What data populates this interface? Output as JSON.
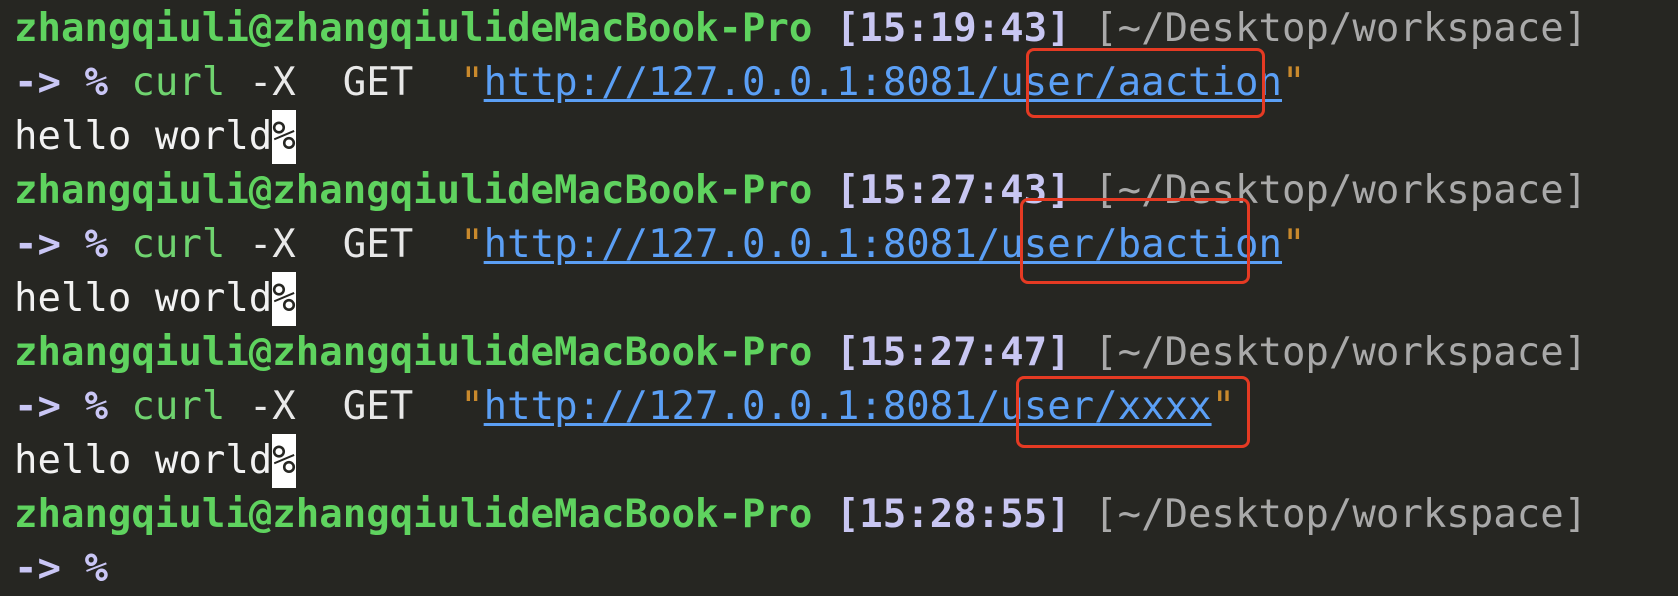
{
  "session": {
    "blocks": [
      {
        "prompt": {
          "user": "zhangqiuli@zhangqiulideMacBook-Pro",
          "time": "[15:19:43]",
          "path": "[~/Desktop/workspace]"
        },
        "command": {
          "arrow": "->",
          "symbol": "%",
          "cmd": "curl",
          "flag": "-X",
          "method": "GET",
          "open_quote": "\"",
          "url": "http://127.0.0.1:8081/user/aaction",
          "close_quote": "\""
        },
        "output": "hello world",
        "cursor": "%"
      },
      {
        "prompt": {
          "user": "zhangqiuli@zhangqiulideMacBook-Pro",
          "time": "[15:27:43]",
          "path": "[~/Desktop/workspace]"
        },
        "command": {
          "arrow": "->",
          "symbol": "%",
          "cmd": "curl",
          "flag": "-X",
          "method": "GET",
          "open_quote": "\"",
          "url": "http://127.0.0.1:8081/user/baction",
          "close_quote": "\""
        },
        "output": "hello world",
        "cursor": "%"
      },
      {
        "prompt": {
          "user": "zhangqiuli@zhangqiulideMacBook-Pro",
          "time": "[15:27:47]",
          "path": "[~/Desktop/workspace]"
        },
        "command": {
          "arrow": "->",
          "symbol": "%",
          "cmd": "curl",
          "flag": "-X",
          "method": "GET",
          "open_quote": "\"",
          "url": "http://127.0.0.1:8081/user/xxxx",
          "close_quote": "\""
        },
        "output": "hello world",
        "cursor": "%"
      },
      {
        "prompt": {
          "user": "zhangqiuli@zhangqiulideMacBook-Pro",
          "time": "[15:28:55]",
          "path": "[~/Desktop/workspace]"
        },
        "command": {
          "arrow": "->",
          "symbol": "%"
        }
      }
    ]
  },
  "colors": {
    "background": "#262622",
    "user": "#5fd35f",
    "url": "#5b9ff5",
    "highlight": "#e53a23"
  }
}
